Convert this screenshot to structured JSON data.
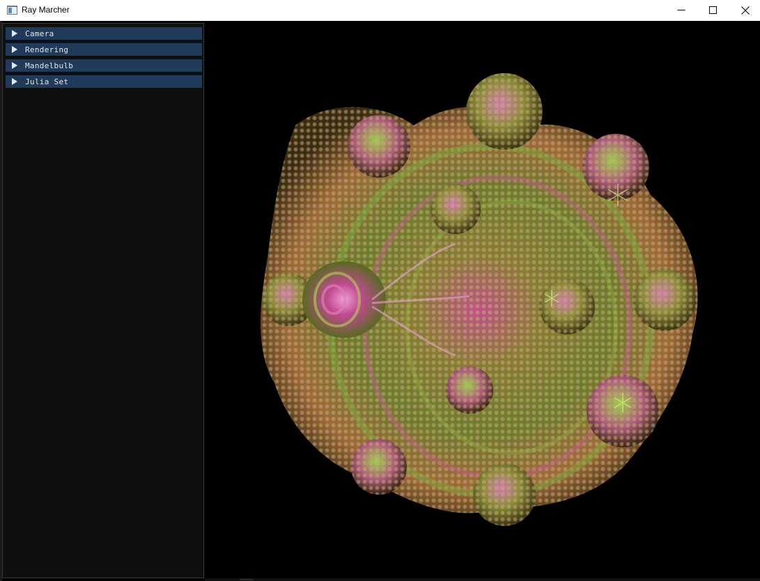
{
  "window": {
    "title": "Ray Marcher"
  },
  "panel": {
    "headers": [
      {
        "label": "Camera"
      },
      {
        "label": "Rendering"
      },
      {
        "label": "Mandelbulb"
      },
      {
        "label": "Julia Set"
      }
    ]
  },
  "viewport": {
    "content": "mandelbulb-fractal-render"
  }
}
